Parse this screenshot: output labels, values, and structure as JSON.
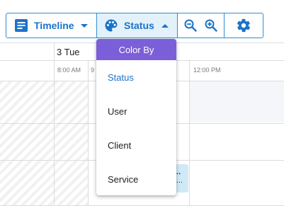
{
  "toolbar": {
    "timeline_label": "Timeline",
    "status_label": "Status",
    "icons": [
      "view-list-icon",
      "palette-icon",
      "zoom-out-icon",
      "zoom-in-icon",
      "gear-icon"
    ]
  },
  "calendar": {
    "day_label": "3 Tue",
    "times": [
      "8:00 AM",
      "9",
      "12:00 PM"
    ],
    "event": {
      "title": "y…",
      "subtitle": "0 …"
    }
  },
  "color_by_menu": {
    "header": "Color By",
    "items": [
      {
        "label": "Status",
        "selected": true
      },
      {
        "label": "User",
        "selected": false
      },
      {
        "label": "Client",
        "selected": false
      },
      {
        "label": "Service",
        "selected": false
      }
    ]
  },
  "colors": {
    "accent": "#1a73c8",
    "menu_header": "#7b5fd9",
    "event_bg": "#cfe9f7"
  }
}
